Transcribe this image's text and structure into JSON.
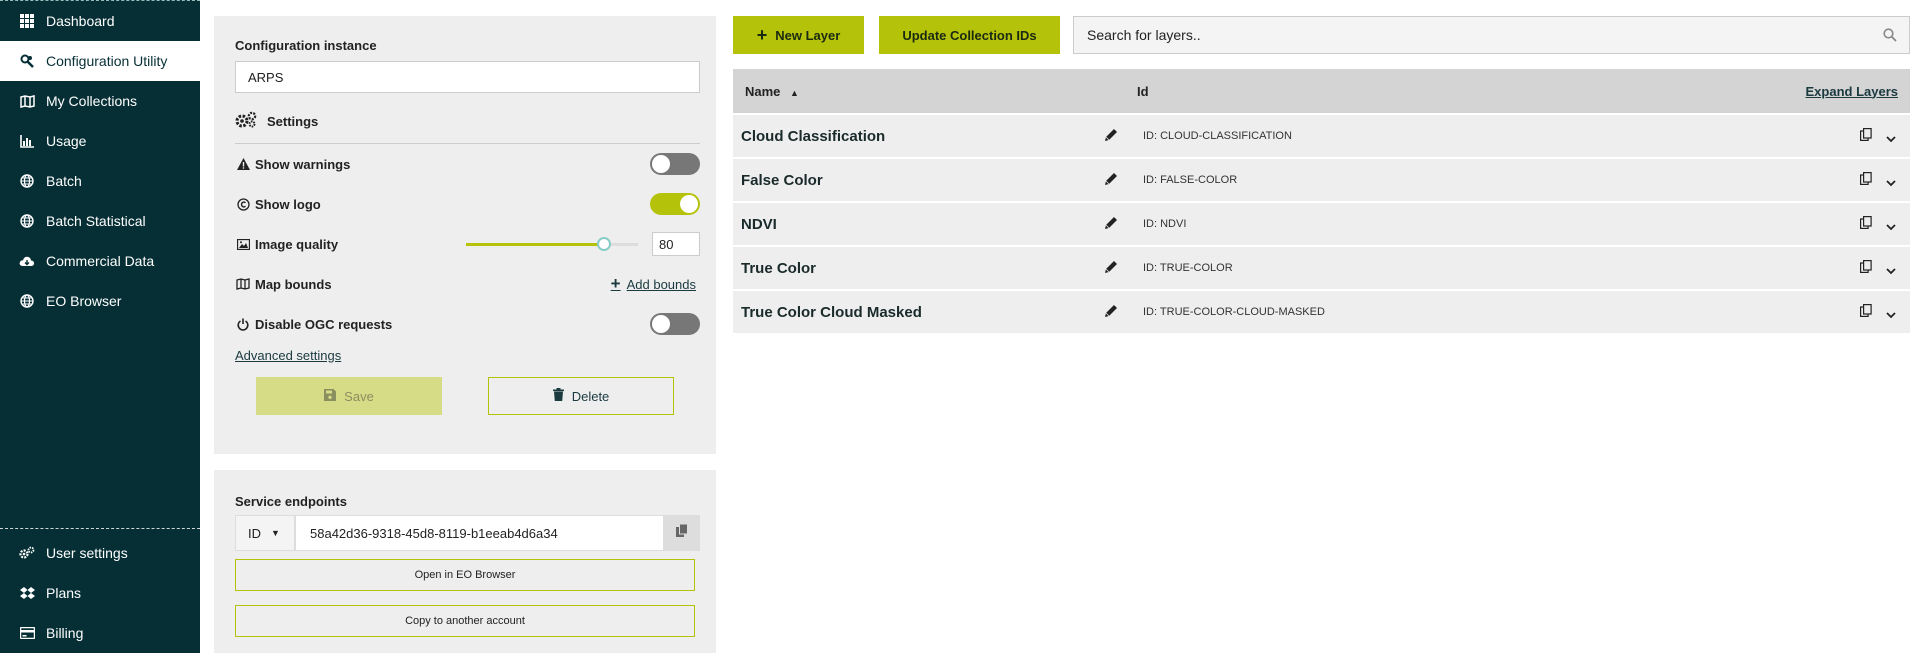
{
  "sidebar": {
    "items": [
      {
        "label": "Dashboard",
        "icon": "grid-icon"
      },
      {
        "label": "Configuration Utility",
        "icon": "wrench-icon"
      },
      {
        "label": "My Collections",
        "icon": "map-icon"
      },
      {
        "label": "Usage",
        "icon": "bar-chart-icon"
      },
      {
        "label": "Batch",
        "icon": "globe-icon"
      },
      {
        "label": "Batch Statistical",
        "icon": "globe-icon"
      },
      {
        "label": "Commercial Data",
        "icon": "cloud-download-icon"
      },
      {
        "label": "EO Browser",
        "icon": "globe-icon"
      }
    ],
    "bottom_items": [
      {
        "label": "User settings",
        "icon": "gears-icon"
      },
      {
        "label": "Plans",
        "icon": "dropbox-icon"
      },
      {
        "label": "Billing",
        "icon": "credit-card-icon"
      }
    ],
    "active": "Configuration Utility"
  },
  "config": {
    "instance_label": "Configuration instance",
    "instance_value": "ARPS",
    "settings_label": "Settings",
    "show_warnings_label": "Show warnings",
    "show_warnings_on": false,
    "show_logo_label": "Show logo",
    "show_logo_on": true,
    "image_quality_label": "Image quality",
    "image_quality_value": "80",
    "map_bounds_label": "Map bounds",
    "add_bounds_label": "Add bounds",
    "disable_ogc_label": "Disable OGC requests",
    "disable_ogc_on": false,
    "advanced_label": "Advanced settings",
    "save_label": "Save",
    "delete_label": "Delete"
  },
  "service": {
    "title": "Service endpoints",
    "id_selector": "ID",
    "id_value": "58a42d36-9318-45d8-8119-b1eeab4d6a34",
    "open_eo_label": "Open in EO Browser",
    "copy_account_label": "Copy to another account"
  },
  "toolbar": {
    "new_layer_label": "New Layer",
    "update_ids_label": "Update Collection IDs",
    "search_placeholder": "Search for layers.."
  },
  "layers": {
    "col_name": "Name",
    "col_id": "Id",
    "expand_label": "Expand Layers",
    "rows": [
      {
        "name": "Cloud Classification",
        "id": "ID: CLOUD-CLASSIFICATION"
      },
      {
        "name": "False Color",
        "id": "ID: FALSE-COLOR"
      },
      {
        "name": "NDVI",
        "id": "ID: NDVI"
      },
      {
        "name": "True Color",
        "id": "ID: TRUE-COLOR"
      },
      {
        "name": "True Color Cloud Masked",
        "id": "ID: TRUE-COLOR-CLOUD-MASKED"
      }
    ]
  },
  "colors": {
    "sidebar_bg": "#062f35",
    "accent": "#b5c20a",
    "panel_bg": "#eeeeee"
  }
}
